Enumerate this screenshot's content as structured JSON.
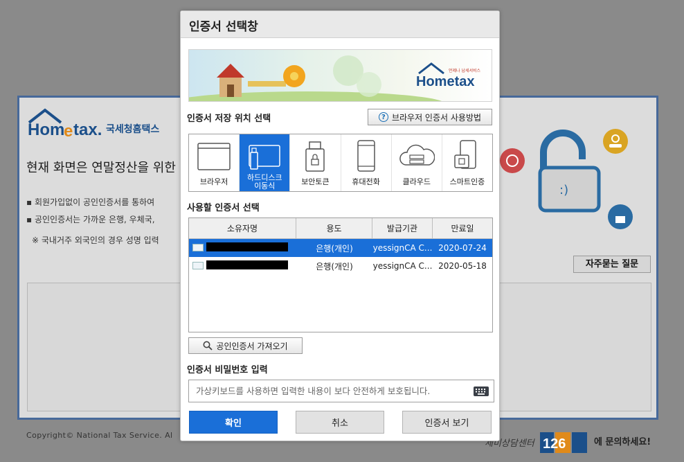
{
  "background": {
    "logo": {
      "brand": "Hometax",
      "subtitle": "국세청홈택스",
      "tagline": "언제나 납세서비스"
    },
    "title": "현재 화면은 연말정산을 위한 로",
    "bullets": [
      "회원가입없이 공인인증서를 통하여",
      "공인인증서는 가까운 은행, 우체국,"
    ],
    "note": "※ 국내거주 외국인의 경우 성명 입력",
    "faq_button": "자주묻는 질문",
    "copyright": "Copyright© National Tax Service. Al",
    "center_text": "에 문의하세요!",
    "center_number": "126",
    "center_label": "세미상담센터"
  },
  "dialog": {
    "title": "인증서 선택창",
    "banner_logo": "Hometax",
    "banner_tagline": "언제나 납세서비스",
    "storage_label": "인증서 저장 위치 선택",
    "help_button": "브라우저 인증서 사용방법",
    "locations": [
      {
        "label": "브라우저",
        "icon": "browser-icon",
        "selected": false
      },
      {
        "label": "하드디스크\n이동식",
        "icon": "usb-drive-icon",
        "selected": true
      },
      {
        "label": "보안토큰",
        "icon": "security-token-icon",
        "selected": false
      },
      {
        "label": "휴대전화",
        "icon": "mobile-phone-icon",
        "selected": false
      },
      {
        "label": "클라우드",
        "icon": "cloud-icon",
        "selected": false
      },
      {
        "label": "스마트인증",
        "icon": "smart-auth-icon",
        "selected": false
      }
    ],
    "cert_label": "사용할 인증서 선택",
    "table": {
      "headers": [
        "소유자명",
        "용도",
        "발급기관",
        "만료일"
      ],
      "rows": [
        {
          "purpose": "은행(개인)",
          "issuer": "yessignCA C...",
          "expiry": "2020-07-24",
          "selected": true
        },
        {
          "purpose": "은행(개인)",
          "issuer": "yessignCA C...",
          "expiry": "2020-05-18",
          "selected": false
        }
      ]
    },
    "import_button": "공인인증서 가져오기",
    "password_label": "인증서 비밀번호 입력",
    "password_placeholder": "가상키보드를 사용하면 입력한 내용이 보다 안전하게 보호됩니다.",
    "buttons": {
      "ok": "확인",
      "cancel": "취소",
      "view": "인증서 보기"
    },
    "colors": {
      "accent": "#1a6fd8",
      "header_bg": "#e9e9e9"
    }
  }
}
